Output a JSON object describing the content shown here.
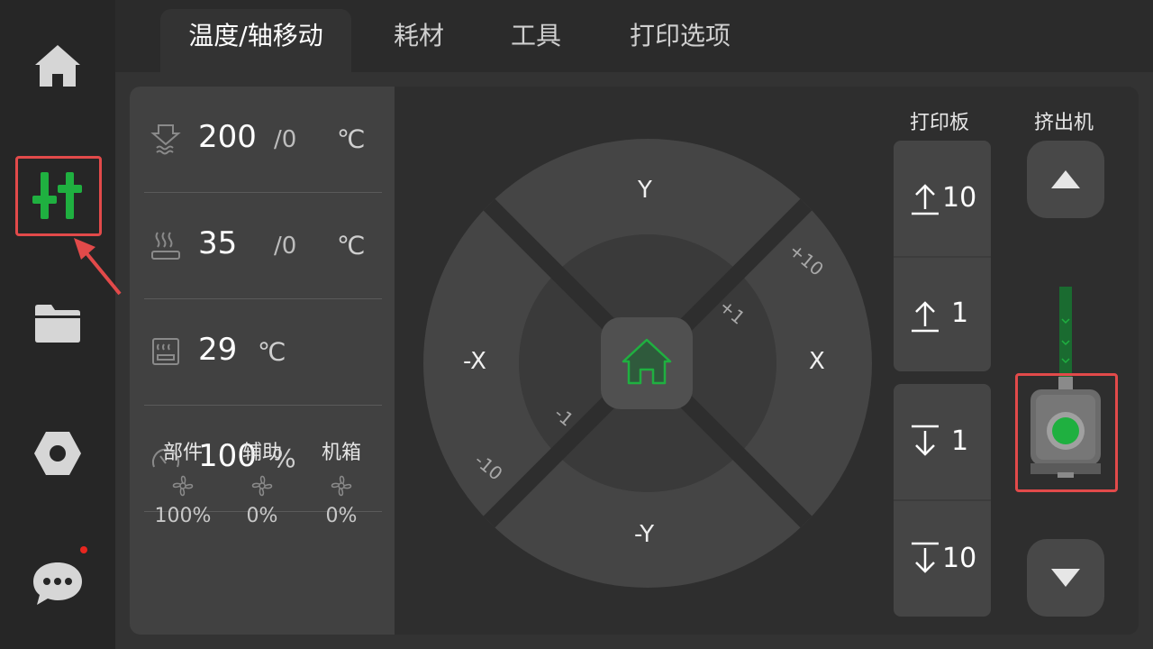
{
  "tabs": [
    "温度/轴移动",
    "耗材",
    "工具",
    "打印选项"
  ],
  "sidebar": {
    "items": [
      "home-icon",
      "tune-sliders-icon",
      "folder-icon",
      "settings-hex-icon",
      "chat-icon"
    ],
    "active_index": 1
  },
  "temps": {
    "nozzle": {
      "current": "200",
      "target": "/0",
      "unit": "℃"
    },
    "bed": {
      "current": "35",
      "target": "/0",
      "unit": "℃"
    },
    "chamber": {
      "current": "29",
      "unit": "℃"
    },
    "speed": {
      "value": "100",
      "unit": "%"
    }
  },
  "fans": [
    {
      "name": "部件",
      "value": "100%"
    },
    {
      "name": "辅助",
      "value": "0%"
    },
    {
      "name": "机箱",
      "value": "0%"
    }
  ],
  "jog": {
    "y_plus": "Y",
    "y_minus": "-Y",
    "x_plus": "X",
    "x_minus": "-X",
    "step_plus_small": "+1",
    "step_plus_large": "+10",
    "step_minus_small": "-1",
    "step_minus_large": "-10"
  },
  "bed_column": {
    "label": "打印板",
    "buttons": [
      "10",
      "1",
      "1",
      "10"
    ]
  },
  "extruder_column": {
    "label": "挤出机"
  },
  "colors": {
    "accent_green": "#1fb040",
    "highlight_red": "#e24a4a"
  }
}
